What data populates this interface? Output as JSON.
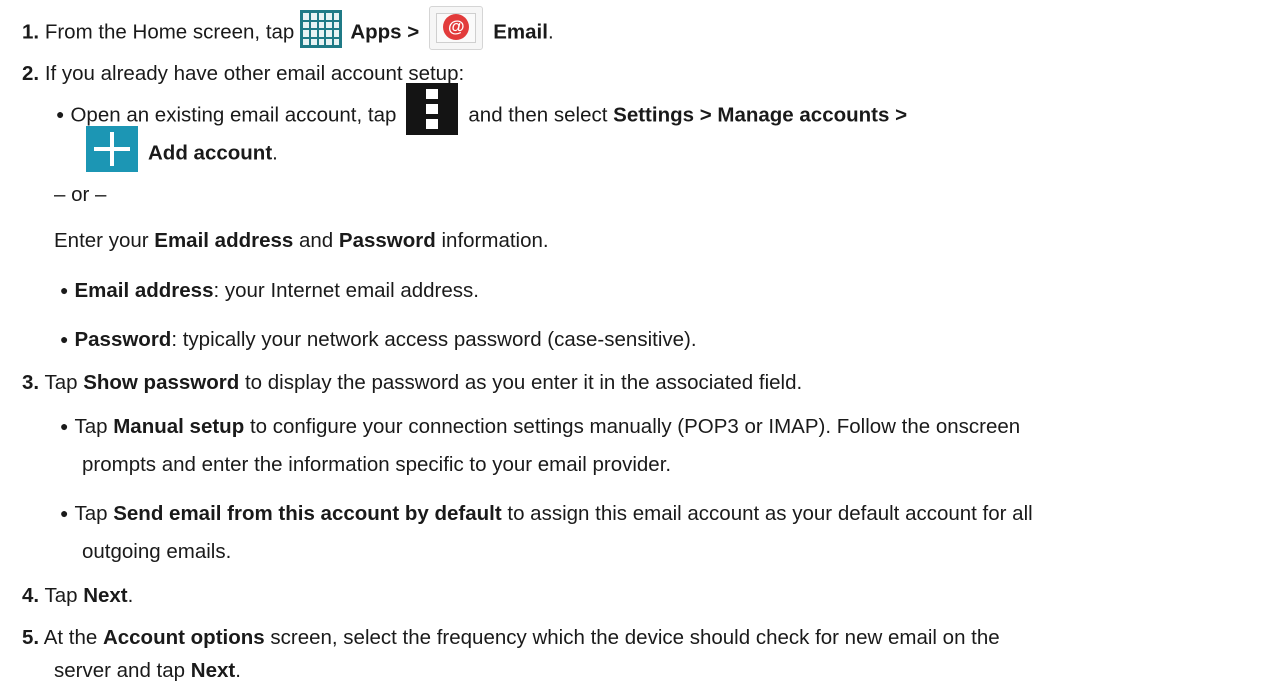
{
  "step1": {
    "num": "1.",
    "pre": "From the Home screen, tap",
    "apps": "Apps >",
    "email": "Email",
    "end": "."
  },
  "step2": {
    "num": "2.",
    "text": "If you already have other email account setup:",
    "bullet_pre": "Open an existing email account, tap",
    "bullet_mid": "and then select",
    "bullet_bold": "Settings > Manage accounts >",
    "add": "Add account",
    "add_end": ".",
    "or": "– or –",
    "enter_pre": "Enter your",
    "enter_b1": "Email address",
    "enter_and": "and",
    "enter_b2": "Password",
    "enter_post": "information.",
    "email_b": "Email address",
    "email_t": ": your Internet email address.",
    "pw_b": "Password",
    "pw_t": ": typically your network access password (case-sensitive)."
  },
  "step3": {
    "num": "3.",
    "pre": "Tap",
    "bold": "Show password",
    "post": "to display the password as you enter it in the associated field.",
    "m_pre": "Tap",
    "m_bold": "Manual setup",
    "m_post1": "to configure your connection settings manually (POP3 or IMAP). Follow the onscreen",
    "m_post2": "prompts and enter the information specific to your email provider.",
    "s_pre": "Tap",
    "s_bold": "Send email from this account by default",
    "s_post1": "to assign this email account as your default account for all",
    "s_post2": "outgoing emails."
  },
  "step4": {
    "num": "4.",
    "pre": "Tap",
    "bold": "Next",
    "end": "."
  },
  "step5": {
    "num": "5.",
    "pre": "At the",
    "bold": "Account options",
    "post1": "screen, select the frequency which the device should check for new email on the",
    "post2": "server and tap",
    "bold2": "Next",
    "end": "."
  },
  "icons": {
    "apps": "apps-grid-icon",
    "email": "email-at-icon",
    "menu": "overflow-menu-icon",
    "plus": "add-plus-icon"
  }
}
